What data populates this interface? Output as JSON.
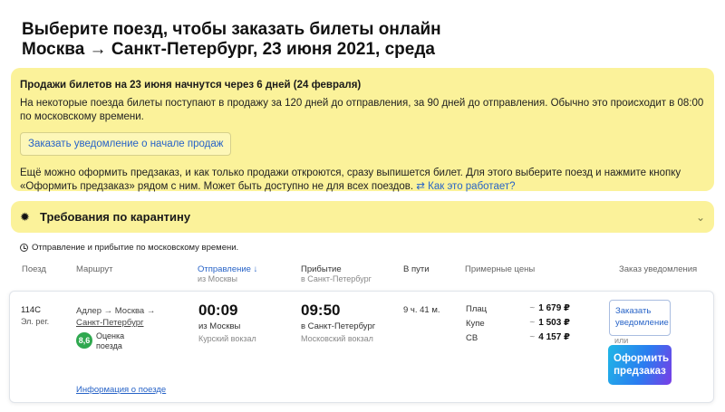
{
  "page": {
    "title_line1": "Выберите поезд, чтобы заказать билеты онлайн",
    "title_line2": "Москва → Санкт-Петербург, 23 июня 2021, среда"
  },
  "notice": {
    "heading": "Продажи билетов на 23 июня начнутся через 6 дней (24 февраля)",
    "text": "На некоторые поезда билеты поступают в продажу за 120 дней до отправления, за 90 дней до отправления. Обычно это происходит в 08:00 по московскому времени.",
    "notify_button": "Заказать уведомление о начале продаж",
    "preorder_text": "Ещё можно оформить предзаказ, и как только продажи откроются, сразу выпишется билет. Для этого выберите поезд и нажмите кнопку «Оформить предзаказ» рядом с ним. Может быть доступно не для всех поездов.",
    "how_link": "Как это работает?"
  },
  "quarantine": {
    "label": "Требования по карантину",
    "icon": "gear-icon",
    "chevron": "chevron-down-icon"
  },
  "timezone_note": "Отправление и прибытие по московскому времени.",
  "columns": {
    "train": "Поезд",
    "route": "Маршрут",
    "departure": "Отправление ↓",
    "departure_sub": "из Москвы",
    "arrival": "Прибытие",
    "arrival_sub": "в Санкт-Петербург",
    "duration": "В пути",
    "prices": "Примерные цены",
    "notify": "Заказ уведомления"
  },
  "train": {
    "number": "114С",
    "category": "Эл. рег.",
    "route_line1": "Адлер → Москва →",
    "route_line2": "Санкт-Петербург",
    "rating": "8,6",
    "rating_label_line1": "Оценка",
    "rating_label_line2": "поезда",
    "dep_time": "00:09",
    "dep_place": "из Москвы",
    "dep_station": "Курский вокзал",
    "arr_time": "09:50",
    "arr_place": "в Санкт-Петербург",
    "arr_station": "Московский вокзал",
    "duration": "9 ч. 41 м.",
    "classes": [
      {
        "name": "Плац",
        "price": "1 679 ₽"
      },
      {
        "name": "Купе",
        "price": "1 503 ₽"
      },
      {
        "name": "СВ",
        "price": "4 157 ₽"
      }
    ],
    "price_prefix": "~",
    "notify_button": "Заказать уведомление",
    "or": "или",
    "preorder_button": "Оформить предзаказ",
    "info_link": "Информация о поезде"
  },
  "colors": {
    "notice_bg": "#fbf29a",
    "link": "#2763c7",
    "rating_green": "#2fa84f"
  }
}
